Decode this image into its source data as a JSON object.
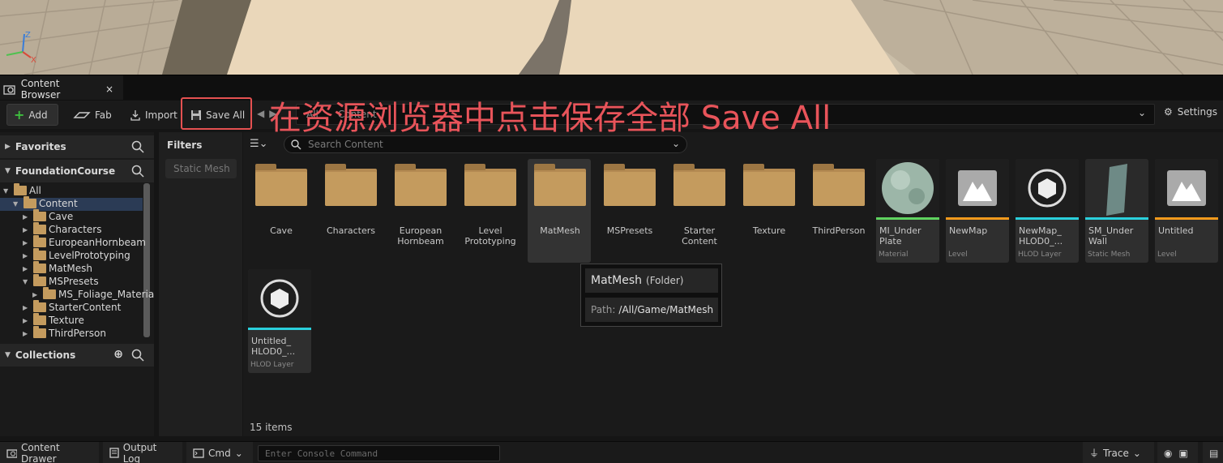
{
  "tab": {
    "title": "Content Browser",
    "close": "×"
  },
  "toolbar": {
    "add": "Add",
    "fab": "Fab",
    "import": "Import",
    "save_all": "Save All",
    "settings": "Settings"
  },
  "annotation": "在资源浏览器中点击保存全部 Save All",
  "path": {
    "segments": [
      "All",
      "Content"
    ]
  },
  "sidebar": {
    "favorites": "Favorites",
    "project": "FoundationCourse",
    "collections": "Collections",
    "tree": [
      {
        "label": "All",
        "depth": 0,
        "expanded": true
      },
      {
        "label": "Content",
        "depth": 1,
        "expanded": true,
        "selected": true
      },
      {
        "label": "Cave",
        "depth": 2
      },
      {
        "label": "Characters",
        "depth": 2
      },
      {
        "label": "EuropeanHornbeam",
        "depth": 2
      },
      {
        "label": "LevelPrototyping",
        "depth": 2
      },
      {
        "label": "MatMesh",
        "depth": 2
      },
      {
        "label": "MSPresets",
        "depth": 2,
        "expanded": true
      },
      {
        "label": "MS_Foliage_Materia",
        "depth": 3
      },
      {
        "label": "StarterContent",
        "depth": 2
      },
      {
        "label": "Texture",
        "depth": 2
      },
      {
        "label": "ThirdPerson",
        "depth": 2
      }
    ]
  },
  "filters": {
    "title": "Filters",
    "chip": "Static Mesh"
  },
  "search": {
    "placeholder": "Search Content"
  },
  "folders": [
    {
      "name": "Cave"
    },
    {
      "name": "Characters"
    },
    {
      "name": "European Hornbeam"
    },
    {
      "name": "Level Prototyping"
    },
    {
      "name": "MatMesh"
    },
    {
      "name": "MSPresets"
    },
    {
      "name": "Starter Content"
    },
    {
      "name": "Texture"
    },
    {
      "name": "ThirdPerson"
    }
  ],
  "assets": [
    {
      "name": "MI_Under Plate",
      "type": "Material",
      "color": "#5fd35f"
    },
    {
      "name": "NewMap",
      "type": "Level",
      "color": "#f29a1c"
    },
    {
      "name": "NewMap_ HLOD0_...",
      "type": "HLOD Layer",
      "color": "#2ad0dc"
    },
    {
      "name": "SM_Under Wall",
      "type": "Static Mesh",
      "color": "#2ad0dc"
    },
    {
      "name": "Untitled",
      "type": "Level",
      "color": "#f29a1c"
    },
    {
      "name": "Untitled_ HLOD0_...",
      "type": "HLOD Layer",
      "color": "#2ad0dc"
    }
  ],
  "tooltip": {
    "name": "MatMesh",
    "kind": "(Folder)",
    "path_label": "Path:",
    "path_value": "/All/Game/MatMesh"
  },
  "items_count": "15 items",
  "bottom": {
    "drawer": "Content Drawer",
    "output": "Output Log",
    "cmd": "Cmd",
    "console_placeholder": "Enter Console Command",
    "trace": "Trace"
  }
}
